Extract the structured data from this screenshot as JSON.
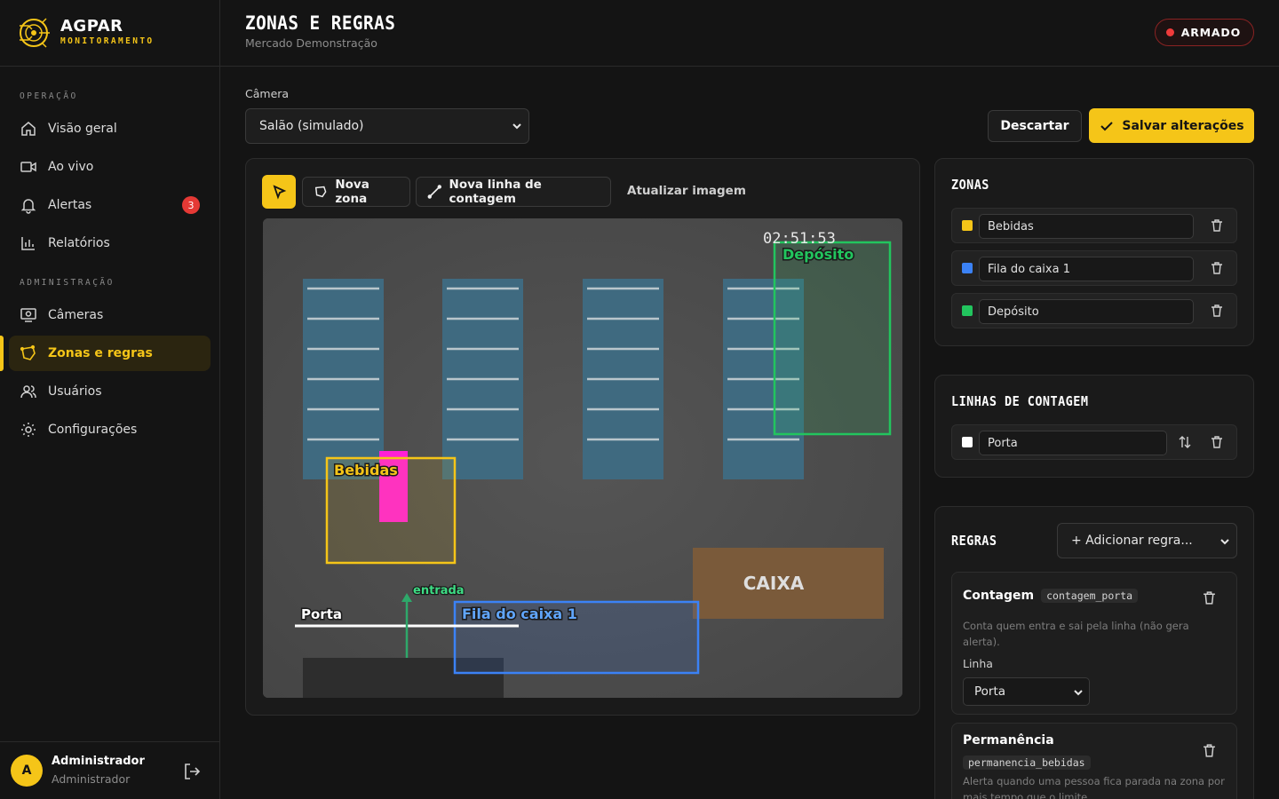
{
  "brand": {
    "name": "AGPAR",
    "subtitle": "MONITORAMENTO"
  },
  "sidebar": {
    "section_operacao": "OPERAÇÃO",
    "section_admin": "ADMINISTRAÇÃO",
    "items": [
      {
        "label": "Visão geral",
        "icon": "home-icon"
      },
      {
        "label": "Ao vivo",
        "icon": "video-icon"
      },
      {
        "label": "Alertas",
        "icon": "bell-icon",
        "badge": "3"
      },
      {
        "label": "Relatórios",
        "icon": "bar-chart-icon"
      },
      {
        "label": "Câmeras",
        "icon": "monitor-icon"
      },
      {
        "label": "Zonas e regras",
        "icon": "polygon-icon",
        "active": true
      },
      {
        "label": "Usuários",
        "icon": "users-icon"
      },
      {
        "label": "Configurações",
        "icon": "sun-gear-icon"
      }
    ]
  },
  "user": {
    "initial": "A",
    "name": "Administrador",
    "role": "Administrador"
  },
  "header": {
    "title": "ZONAS E REGRAS",
    "subtitle": "Mercado Demonstração",
    "status": "ARMADO"
  },
  "camera": {
    "label": "Câmera",
    "selected": "Salão (simulado)"
  },
  "actions": {
    "discard": "Descartar",
    "save": "Salvar alterações"
  },
  "toolbar": {
    "new_zone": "Nova zona",
    "new_line": "Nova linha de contagem",
    "refresh": "Atualizar imagem"
  },
  "preview": {
    "timestamp": "02:51:53",
    "counter_label": "CAIXA",
    "zones": [
      {
        "label": "Bebidas",
        "color": "#f5c518"
      },
      {
        "label": "Fila do caixa 1",
        "color": "#3b82f6"
      },
      {
        "label": "Depósito",
        "color": "#22c55e"
      }
    ],
    "line": {
      "label": "Porta",
      "direction": "entrada",
      "color": "#ffffff"
    }
  },
  "zones_panel": {
    "title": "ZONAS",
    "items": [
      {
        "name": "Bebidas",
        "color": "#f5c518"
      },
      {
        "name": "Fila do caixa 1",
        "color": "#3b82f6"
      },
      {
        "name": "Depósito",
        "color": "#22c55e"
      }
    ]
  },
  "lines_panel": {
    "title": "LINHAS DE CONTAGEM",
    "items": [
      {
        "name": "Porta",
        "color": "#ffffff"
      }
    ]
  },
  "rules_panel": {
    "title": "REGRAS",
    "add_placeholder": "+ Adicionar regra...",
    "rules": [
      {
        "name": "Contagem",
        "code": "contagem_porta",
        "description": "Conta quem entra e sai pela linha (não gera alerta).",
        "field_label": "Linha",
        "field_value": "Porta"
      },
      {
        "name": "Permanência",
        "code": "permanencia_bebidas",
        "description": "Alerta quando uma pessoa fica parada na zona por mais tempo que o limite"
      }
    ]
  }
}
